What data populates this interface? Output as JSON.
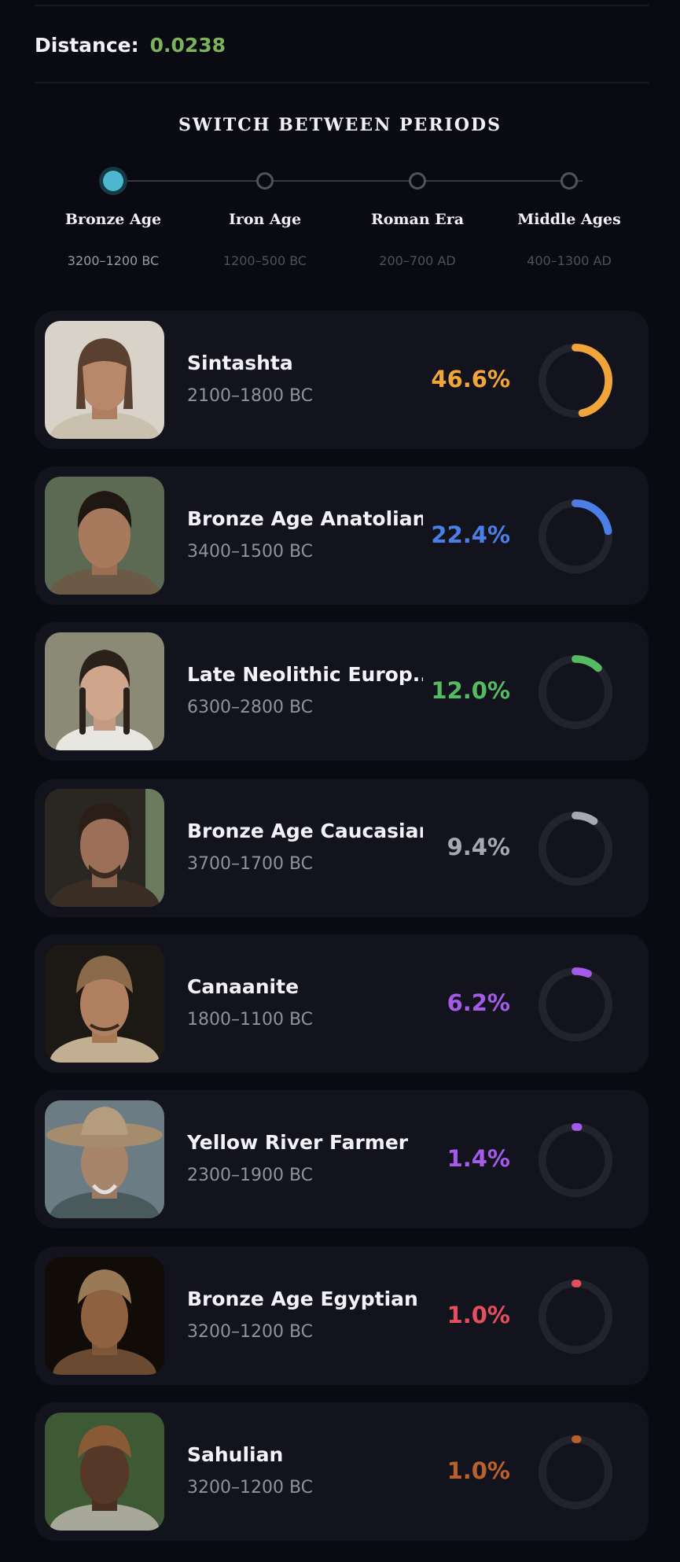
{
  "distance": {
    "label": "Distance:",
    "value": "0.0238",
    "value_color": "#7cb25a"
  },
  "periods": {
    "title": "SWITCH BETWEEN PERIODS",
    "items": [
      {
        "name": "Bronze Age",
        "range": "3200–1200 BC",
        "active": true
      },
      {
        "name": "Iron Age",
        "range": "1200–500 BC",
        "active": false
      },
      {
        "name": "Roman Era",
        "range": "200–700 AD",
        "active": false
      },
      {
        "name": "Middle Ages",
        "range": "400–1300 AD",
        "active": false
      }
    ],
    "active_color": "#4fb6d0"
  },
  "populations": [
    {
      "name": "Sintashta",
      "range": "2100–1800 BC",
      "percent": "46.6%",
      "fraction": 0.466,
      "color": "#f0a43a",
      "portrait": "portrait-sintashta"
    },
    {
      "name": "Bronze Age Anatolian",
      "range": "3400–1500 BC",
      "percent": "22.4%",
      "fraction": 0.224,
      "color": "#4b7fe6",
      "portrait": "portrait-anatolian"
    },
    {
      "name": "Late Neolithic Europ...",
      "range": "6300–2800 BC",
      "percent": "12.0%",
      "fraction": 0.12,
      "color": "#55bb63",
      "portrait": "portrait-neolithic-european"
    },
    {
      "name": "Bronze Age Caucasian",
      "range": "3700–1700 BC",
      "percent": "9.4%",
      "fraction": 0.094,
      "color": "#a8a8b0",
      "portrait": "portrait-caucasian"
    },
    {
      "name": "Canaanite",
      "range": "1800–1100 BC",
      "percent": "6.2%",
      "fraction": 0.062,
      "color": "#a45ce8",
      "portrait": "portrait-canaanite"
    },
    {
      "name": "Yellow River Farmer",
      "range": "2300–1900 BC",
      "percent": "1.4%",
      "fraction": 0.014,
      "color": "#a45ce8",
      "portrait": "portrait-yellow-river"
    },
    {
      "name": "Bronze Age Egyptian",
      "range": "3200–1200 BC",
      "percent": "1.0%",
      "fraction": 0.01,
      "color": "#e44e5e",
      "portrait": "portrait-egyptian"
    },
    {
      "name": "Sahulian",
      "range": "3200–1200 BC",
      "percent": "1.0%",
      "fraction": 0.01,
      "color": "#b9612c",
      "portrait": "portrait-sahulian"
    }
  ]
}
